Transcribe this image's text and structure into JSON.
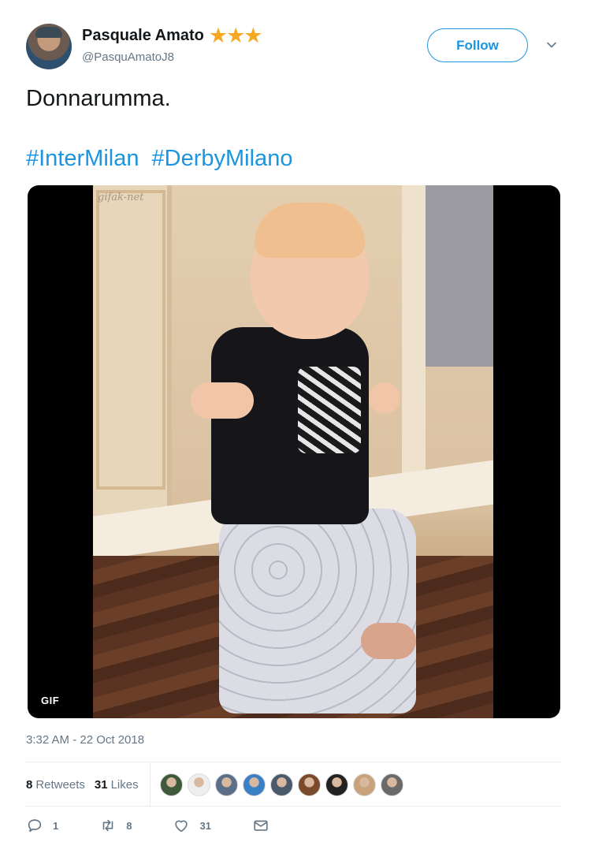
{
  "author": {
    "display_name": "Pasquale Amato",
    "badge": "★★★",
    "handle": "@PasquAmatoJ8"
  },
  "header": {
    "follow_label": "Follow"
  },
  "tweet": {
    "text": "Donnarumma.",
    "hashtags": [
      "#InterMilan",
      "#DerbyMilano"
    ],
    "timestamp": "3:32 AM - 22 Oct 2018"
  },
  "media": {
    "type_badge": "GIF",
    "watermark": "gifak-net"
  },
  "stats": {
    "retweets_count": "8",
    "retweets_label": "Retweets",
    "likes_count": "31",
    "likes_label": "Likes",
    "liker_avatars": [
      "#3e5a3a",
      "#eeeeee",
      "#5c6f88",
      "#3b7fc4",
      "#4a5a6a",
      "#7a4b2a",
      "#222222",
      "#c8a27a",
      "#6a6a6a"
    ]
  },
  "actions": {
    "reply_count": "1",
    "retweet_count": "8",
    "like_count": "31"
  },
  "colors": {
    "link_blue": "#1b95e0",
    "secondary_text": "#657786",
    "star_gold": "#f7a823"
  }
}
